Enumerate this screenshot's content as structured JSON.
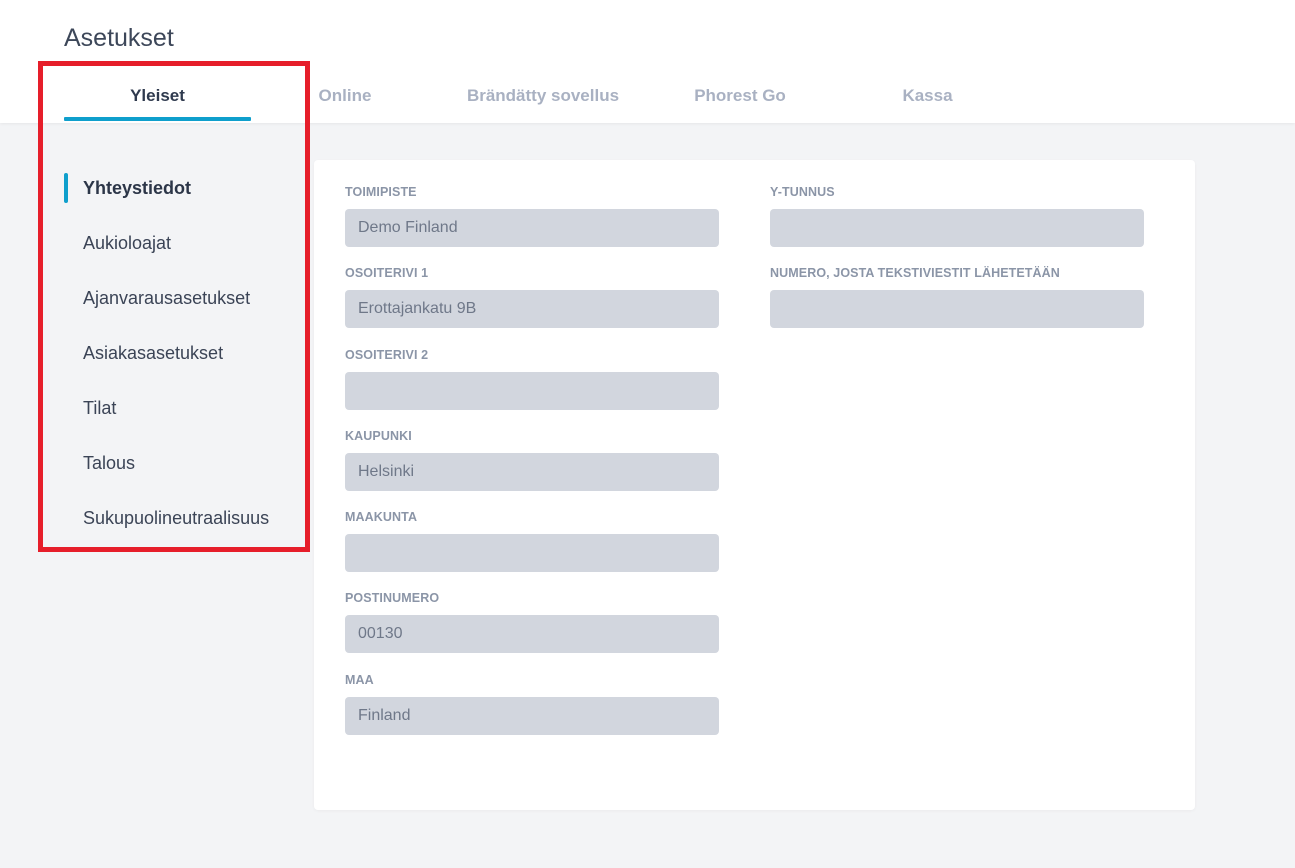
{
  "page": {
    "title": "Asetukset"
  },
  "tabs": [
    {
      "label": "Yleiset",
      "active": true
    },
    {
      "label": "Online",
      "active": false
    },
    {
      "label": "Brändätty sovellus",
      "active": false
    },
    {
      "label": "Phorest Go",
      "active": false
    },
    {
      "label": "Kassa",
      "active": false
    }
  ],
  "sidebar": {
    "items": [
      {
        "label": "Yhteystiedot",
        "active": true
      },
      {
        "label": "Aukioloajat",
        "active": false
      },
      {
        "label": "Ajanvarausasetukset",
        "active": false
      },
      {
        "label": "Asiakasasetukset",
        "active": false
      },
      {
        "label": "Tilat",
        "active": false
      },
      {
        "label": "Talous",
        "active": false
      },
      {
        "label": "Sukupuolineutraalisuus",
        "active": false
      }
    ]
  },
  "form": {
    "left": [
      {
        "label": "TOIMIPISTE",
        "value": "Demo Finland"
      },
      {
        "label": "OSOITERIVI 1",
        "value": "Erottajankatu 9B"
      },
      {
        "label": "OSOITERIVI 2",
        "value": ""
      },
      {
        "label": "KAUPUNKI",
        "value": "Helsinki"
      },
      {
        "label": "MAAKUNTA",
        "value": ""
      },
      {
        "label": "POSTINUMERO",
        "value": "00130"
      },
      {
        "label": "MAA",
        "value": "Finland"
      }
    ],
    "right": [
      {
        "label": "Y-TUNNUS",
        "value": ""
      },
      {
        "label": "NUMERO, JOSTA TEKSTIVIESTIT LÄHETETÄÄN",
        "value": ""
      }
    ]
  },
  "colors": {
    "accent": "#0f9fcc",
    "highlight": "#e61e2a",
    "input_bg": "#d2d6de"
  }
}
